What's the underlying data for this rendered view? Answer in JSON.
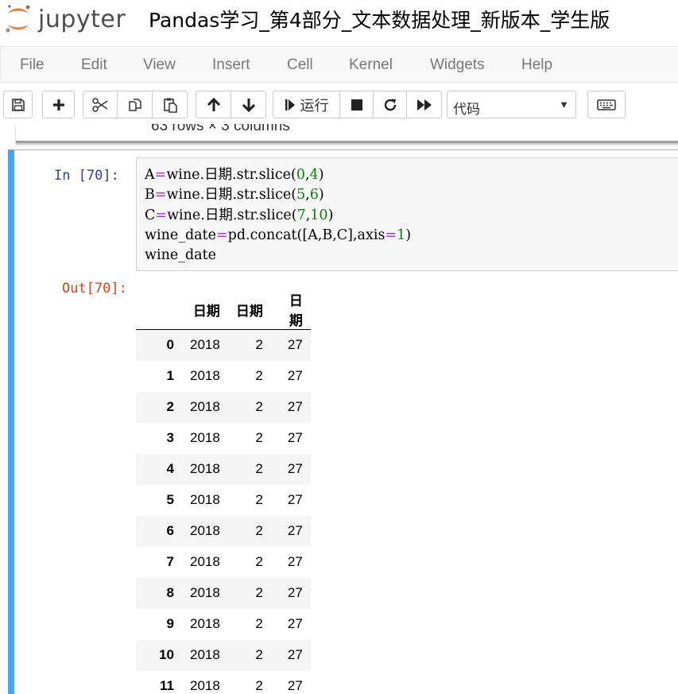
{
  "header": {
    "logo_text": "jupyter",
    "notebook_title": "Pandas学习_第4部分_文本数据处理_新版本_学生版"
  },
  "menubar": {
    "items": [
      "File",
      "Edit",
      "View",
      "Insert",
      "Cell",
      "Kernel",
      "Widgets",
      "Help"
    ]
  },
  "toolbar": {
    "icons": [
      "save-icon",
      "plus-icon",
      "cut-icon",
      "copy-icon",
      "paste-icon",
      "arrow-up-icon",
      "arrow-down-icon",
      "run-icon",
      "stop-icon",
      "restart-icon",
      "fast-forward-icon",
      "keyboard-icon"
    ],
    "run_label": "运行",
    "cell_type": "代码"
  },
  "previous_output": {
    "text": "63 rows × 3 columns"
  },
  "cell": {
    "in_prompt": "In  [70]:",
    "out_prompt": "Out[70]:",
    "code_lines": [
      "A=wine.日期.str.slice(0,4)",
      "B=wine.日期.str.slice(5,6)",
      "C=wine.日期.str.slice(7,10)",
      "wine_date=pd.concat([A,B,C],axis=1)",
      "wine_date"
    ],
    "colors": {
      "accent_bar": "#42a5f5",
      "in_prompt": "#303f9f",
      "out_prompt": "#d84315",
      "operator": "#aa22ff",
      "number": "#008800"
    }
  },
  "dataframe": {
    "columns": [
      "",
      "日期",
      "日期",
      "日期"
    ],
    "rows": [
      [
        "0",
        "2018",
        "2",
        "27"
      ],
      [
        "1",
        "2018",
        "2",
        "27"
      ],
      [
        "2",
        "2018",
        "2",
        "27"
      ],
      [
        "3",
        "2018",
        "2",
        "27"
      ],
      [
        "4",
        "2018",
        "2",
        "27"
      ],
      [
        "5",
        "2018",
        "2",
        "27"
      ],
      [
        "6",
        "2018",
        "2",
        "27"
      ],
      [
        "7",
        "2018",
        "2",
        "27"
      ],
      [
        "8",
        "2018",
        "2",
        "27"
      ],
      [
        "9",
        "2018",
        "2",
        "27"
      ],
      [
        "10",
        "2018",
        "2",
        "27"
      ],
      [
        "11",
        "2018",
        "2",
        "27"
      ]
    ]
  }
}
